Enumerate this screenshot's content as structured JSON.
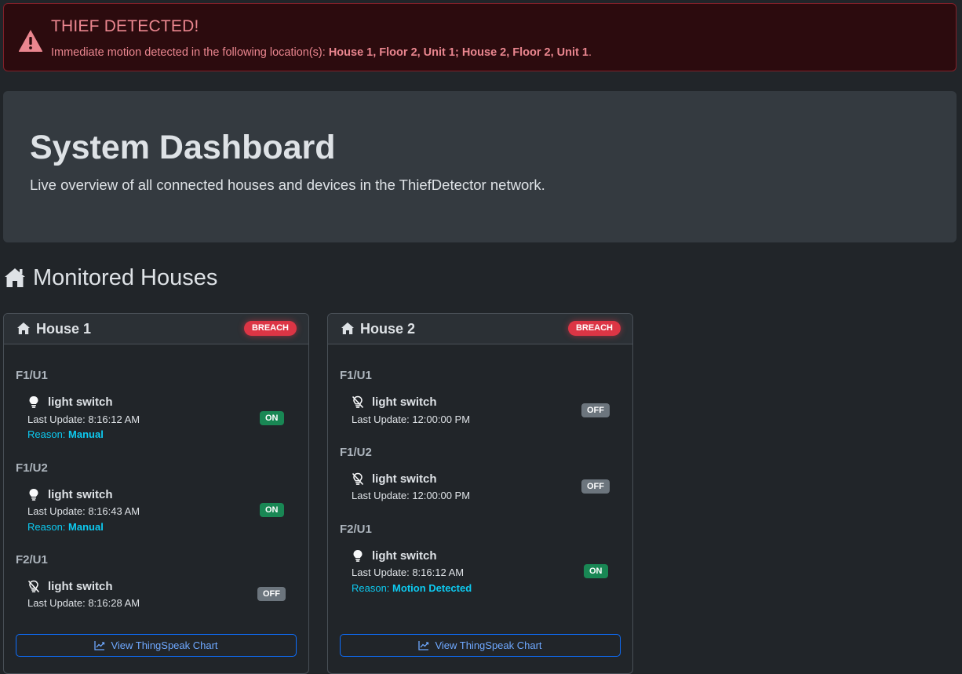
{
  "alert": {
    "title": "THIEF DETECTED!",
    "message_prefix": "Immediate motion detected in the following location(s): ",
    "locations": "House 1, Floor 2, Unit 1; House 2, Floor 2, Unit 1",
    "message_suffix": ".",
    "icon": "warning-triangle-icon",
    "color": "#ea868f"
  },
  "hero": {
    "title": "System Dashboard",
    "subtitle": "Live overview of all connected houses and devices in the ThiefDetector network."
  },
  "section": {
    "title": "Monitored Houses",
    "icon": "house-icon"
  },
  "houses": [
    {
      "name": "House 1",
      "status": "BREACH",
      "chart_button": "View ThingSpeak Chart",
      "units": [
        {
          "label": "F1/U1",
          "device": "light switch",
          "update": "Last Update: 8:16:12 AM",
          "reason_label": "Reason: ",
          "reason": "Manual",
          "state": "ON",
          "icon": "lightbulb-icon"
        },
        {
          "label": "F1/U2",
          "device": "light switch",
          "update": "Last Update: 8:16:43 AM",
          "reason_label": "Reason: ",
          "reason": "Manual",
          "state": "ON",
          "icon": "lightbulb-icon"
        },
        {
          "label": "F2/U1",
          "device": "light switch",
          "update": "Last Update: 8:16:28 AM",
          "state": "OFF",
          "icon": "lightbulb-off-icon"
        }
      ]
    },
    {
      "name": "House 2",
      "status": "BREACH",
      "chart_button": "View ThingSpeak Chart",
      "units": [
        {
          "label": "F1/U1",
          "device": "light switch",
          "update": "Last Update: 12:00:00 PM",
          "state": "OFF",
          "icon": "lightbulb-off-icon"
        },
        {
          "label": "F1/U2",
          "device": "light switch",
          "update": "Last Update: 12:00:00 PM",
          "state": "OFF",
          "icon": "lightbulb-off-icon"
        },
        {
          "label": "F2/U1",
          "device": "light switch",
          "update": "Last Update: 8:16:12 AM",
          "reason_label": "Reason: ",
          "reason": "Motion Detected",
          "state": "ON",
          "icon": "lightbulb-icon"
        }
      ]
    }
  ],
  "colors": {
    "background": "#212529",
    "breach": "#dc3545",
    "on": "#198754",
    "off": "#6c757d",
    "reason": "#0dcaf0",
    "button": "#0d6efd"
  }
}
